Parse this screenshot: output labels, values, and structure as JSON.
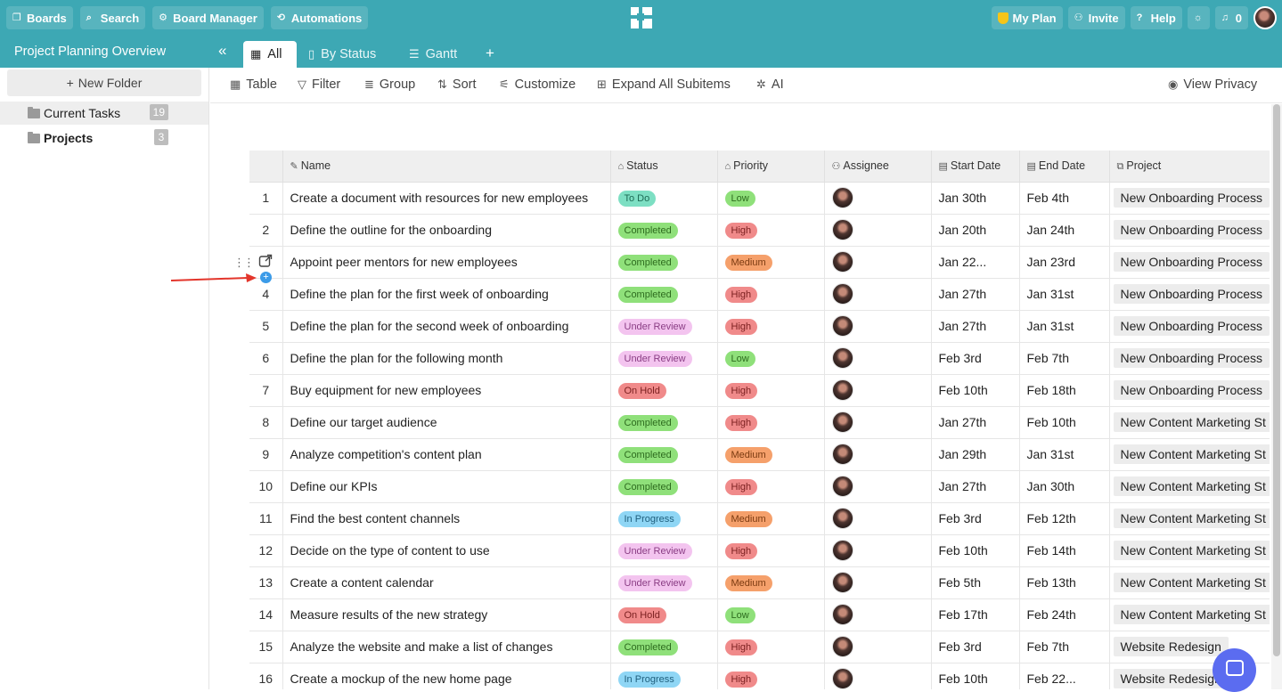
{
  "topbar": {
    "boards": "Boards",
    "search": "Search",
    "board_manager": "Board Manager",
    "automations": "Automations",
    "my_plan": "My Plan",
    "invite": "Invite",
    "help": "Help",
    "notifications_count": "0"
  },
  "subbar": {
    "project_title": "Project Planning Overview",
    "tabs": [
      {
        "label": "All"
      },
      {
        "label": "By Status"
      },
      {
        "label": "Gantt"
      }
    ]
  },
  "sidebar": {
    "new_folder": "New Folder",
    "folders": [
      {
        "label": "Current Tasks",
        "count": "19"
      },
      {
        "label": "Projects",
        "count": "3"
      }
    ]
  },
  "toolbar": {
    "table": "Table",
    "filter": "Filter",
    "group": "Group",
    "sort": "Sort",
    "customize": "Customize",
    "expand": "Expand All Subitems",
    "ai": "AI",
    "view_privacy": "View Privacy"
  },
  "columns": [
    "Name",
    "Status",
    "Priority",
    "Assignee",
    "Start Date",
    "End Date",
    "Project"
  ],
  "status_colors": {
    "To Do": {
      "bg": "#7ddfc3",
      "fg": "#1d6b55"
    },
    "Completed": {
      "bg": "#8fe07a",
      "fg": "#2d6b1e"
    },
    "Under Review": {
      "bg": "#f3c4ef",
      "fg": "#8a3d84"
    },
    "On Hold": {
      "bg": "#f08a8a",
      "fg": "#7a1f1f"
    },
    "In Progress": {
      "bg": "#8fd6f5",
      "fg": "#1f5f7d"
    }
  },
  "priority_colors": {
    "Low": {
      "bg": "#8fe07a",
      "fg": "#2d6b1e"
    },
    "High": {
      "bg": "#f08a8a",
      "fg": "#7a1f1f"
    },
    "Medium": {
      "bg": "#f5a06b",
      "fg": "#7a3a10"
    }
  },
  "rows": [
    {
      "num": "1",
      "name": "Create a document with resources for new employees",
      "status": "To Do",
      "priority": "Low",
      "start": "Jan 30th",
      "end": "Feb 4th",
      "project": "New Onboarding Process"
    },
    {
      "num": "2",
      "name": "Define the outline for the onboarding",
      "status": "Completed",
      "priority": "High",
      "start": "Jan 20th",
      "end": "Jan 24th",
      "project": "New Onboarding Process"
    },
    {
      "num": "",
      "name": "Appoint peer mentors for new employees",
      "status": "Completed",
      "priority": "Medium",
      "start": "Jan 22...",
      "end": "Jan 23rd",
      "project": "New Onboarding Process"
    },
    {
      "num": "4",
      "name": "Define the plan for the first week of onboarding",
      "status": "Completed",
      "priority": "High",
      "start": "Jan 27th",
      "end": "Jan 31st",
      "project": "New Onboarding Process"
    },
    {
      "num": "5",
      "name": "Define the plan for the second week of onboarding",
      "status": "Under Review",
      "priority": "High",
      "start": "Jan 27th",
      "end": "Jan 31st",
      "project": "New Onboarding Process"
    },
    {
      "num": "6",
      "name": "Define the plan for the following month",
      "status": "Under Review",
      "priority": "Low",
      "start": "Feb 3rd",
      "end": "Feb 7th",
      "project": "New Onboarding Process"
    },
    {
      "num": "7",
      "name": "Buy equipment for new employees",
      "status": "On Hold",
      "priority": "High",
      "start": "Feb 10th",
      "end": "Feb 18th",
      "project": "New Onboarding Process"
    },
    {
      "num": "8",
      "name": "Define our target audience",
      "status": "Completed",
      "priority": "High",
      "start": "Jan 27th",
      "end": "Feb 10th",
      "project": "New Content Marketing St"
    },
    {
      "num": "9",
      "name": "Analyze competition's content plan",
      "status": "Completed",
      "priority": "Medium",
      "start": "Jan 29th",
      "end": "Jan 31st",
      "project": "New Content Marketing St"
    },
    {
      "num": "10",
      "name": "Define our KPIs",
      "status": "Completed",
      "priority": "High",
      "start": "Jan 27th",
      "end": "Jan 30th",
      "project": "New Content Marketing St"
    },
    {
      "num": "11",
      "name": "Find the best content channels",
      "status": "In Progress",
      "priority": "Medium",
      "start": "Feb 3rd",
      "end": "Feb 12th",
      "project": "New Content Marketing St"
    },
    {
      "num": "12",
      "name": "Decide on the type of content to use",
      "status": "Under Review",
      "priority": "High",
      "start": "Feb 10th",
      "end": "Feb 14th",
      "project": "New Content Marketing St"
    },
    {
      "num": "13",
      "name": "Create a content calendar",
      "status": "Under Review",
      "priority": "Medium",
      "start": "Feb 5th",
      "end": "Feb 13th",
      "project": "New Content Marketing St"
    },
    {
      "num": "14",
      "name": "Measure results of the new strategy",
      "status": "On Hold",
      "priority": "Low",
      "start": "Feb 17th",
      "end": "Feb 24th",
      "project": "New Content Marketing St"
    },
    {
      "num": "15",
      "name": "Analyze the website and make a list of changes",
      "status": "Completed",
      "priority": "High",
      "start": "Feb 3rd",
      "end": "Feb 7th",
      "project": "Website Redesign"
    },
    {
      "num": "16",
      "name": "Create a mockup of the new home page",
      "status": "In Progress",
      "priority": "High",
      "start": "Feb 10th",
      "end": "Feb 22...",
      "project": "Website Redesign"
    }
  ]
}
